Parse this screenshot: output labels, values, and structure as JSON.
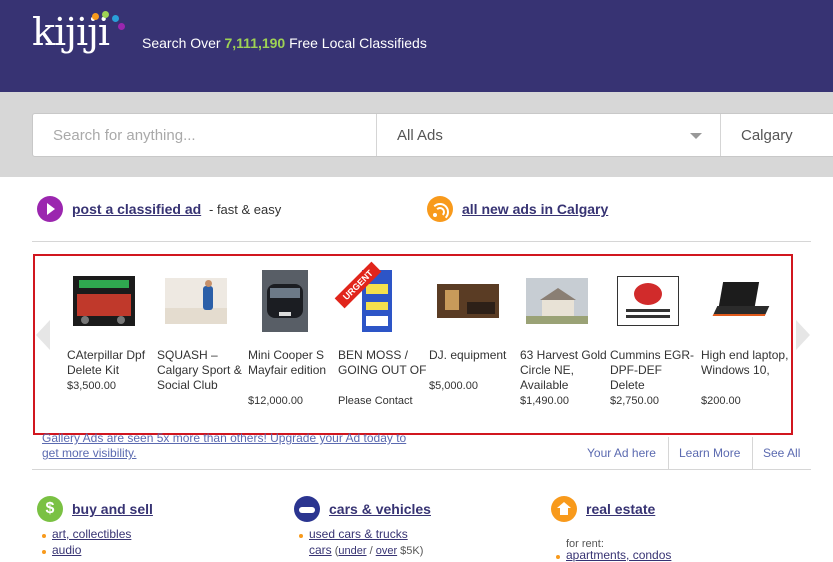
{
  "header": {
    "logo_text": "kijiji",
    "tagline_prefix": "Search Over ",
    "ad_count": "7,111,190",
    "tagline_suffix": " Free Local Classifieds",
    "brand_color": "#373373"
  },
  "search": {
    "placeholder": "Search for anything...",
    "category_value": "All Ads",
    "location_value": "Calgary"
  },
  "actions": {
    "post_label": "post a classified ad",
    "post_suffix": "- fast & easy",
    "new_ads_label": "all new ads in Calgary"
  },
  "gallery": {
    "ads": [
      {
        "title": "CAterpillar Dpf Delete Kit",
        "price": "$3,500.00",
        "thumb": "truck-ad-image"
      },
      {
        "title": "SQUASH – Calgary Sport & Social Club",
        "price": "",
        "thumb": "squash-player-image"
      },
      {
        "title": "Mini Cooper S Mayfair edition",
        "price": "$12,000.00",
        "thumb": "mini-cooper-image"
      },
      {
        "title": "BEN MOSS / GOING OUT OF",
        "price": "Please Contact",
        "thumb": "ben-moss-flyer-image",
        "badge": "URGENT"
      },
      {
        "title": "DJ. equipment",
        "price": "$5,000.00",
        "thumb": "dj-room-image"
      },
      {
        "title": "63 Harvest Gold Circle NE, Available",
        "price": "$1,490.00",
        "thumb": "house-image"
      },
      {
        "title": "Cummins EGR-DPF-DEF Delete",
        "price": "$2,750.00",
        "thumb": "cummins-ad-image"
      },
      {
        "title": "High end laptop, Windows 10,",
        "price": "$200.00",
        "thumb": "laptop-image"
      }
    ],
    "note": "Gallery Ads are seen 5x more than others! Upgrade your Ad today to get more visibility.",
    "links": {
      "your_ad": "Your Ad here",
      "learn_more": "Learn More",
      "see_all": "See All"
    }
  },
  "categories": {
    "buy_sell": {
      "title": "buy and sell",
      "items": [
        "art, collectibles",
        "audio"
      ]
    },
    "cars": {
      "title": "cars & vehicles",
      "item1": "used cars & trucks",
      "cars": "cars",
      "open_paren": " (",
      "under": "under",
      "slash": " / ",
      "over": "over",
      "price_note": " $5K)"
    },
    "real_estate": {
      "title": "real estate",
      "for_rent": "for rent:",
      "item1": "apartments, condos"
    }
  },
  "colors": {
    "accent_red": "#d1161f",
    "post_purple": "#9b26af",
    "orange": "#f89a1c",
    "green": "#7ac143",
    "navy": "#373373"
  }
}
